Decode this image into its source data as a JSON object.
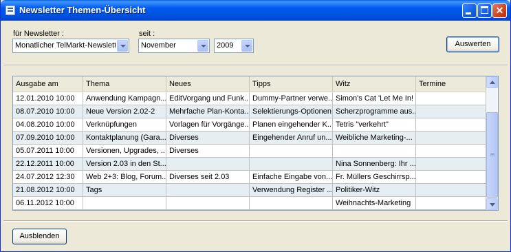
{
  "window": {
    "title": "Newsletter Themen-Übersicht"
  },
  "filters": {
    "newsletter_label": "für Newsletter :",
    "newsletter_value": "Monatlicher TelMarkt-Newslett",
    "since_label": "seit :",
    "month_value": "November",
    "year_value": "2009",
    "evaluate_button": "Auswerten"
  },
  "table": {
    "columns": [
      "Ausgabe am",
      "Thema",
      "Neues",
      "Tipps",
      "Witz",
      "Termine"
    ],
    "rows": [
      [
        "12.01.2010 10:00",
        "Anwendung Kampagn...",
        "EditVorgang und Funk...",
        "Dummy-Partner verwe...",
        "Simon's Cat 'Let Me In!",
        ""
      ],
      [
        "08.07.2010 10:00",
        "Neue Version 2.02-2",
        "Mehrfache Plan-Konta...",
        "Selektierungs-Optionen",
        "Scherzprogramme aus...",
        ""
      ],
      [
        "04.08.2010 10:00",
        "Verknüpfungen",
        "Vorlagen für Vorgänge...",
        "Planen eingehender K...",
        "Tetris \"verkehrt\"",
        ""
      ],
      [
        "07.09.2010 10:00",
        "Kontaktplanung (Gara...",
        "Diverses",
        "Eingehender Anruf un...",
        "Weibliche Marketing-...",
        ""
      ],
      [
        "05.07.2011 10:00",
        "Versionen, Upgrades, ...",
        "Diverses",
        "",
        "",
        ""
      ],
      [
        "22.12.2011 10:00",
        "Version 2.03 in den St...",
        "",
        "",
        "Nina Sonnenberg: Ihr ...",
        ""
      ],
      [
        "24.07.2012 12:30",
        "Web 2+3: Blog, Forum...",
        "Diverses seit 2.03",
        "Einfache Eingabe von...",
        "Fr. Müllers Geschirrsp...",
        ""
      ],
      [
        "21.08.2012 10:00",
        "Tags",
        "",
        "Verwendung Register ...",
        "Politiker-Witz",
        ""
      ],
      [
        "06.11.2012 10:00",
        "",
        "",
        "",
        "Weihnachts-Marketing",
        ""
      ]
    ]
  },
  "footer": {
    "hide_button": "Ausblenden"
  }
}
